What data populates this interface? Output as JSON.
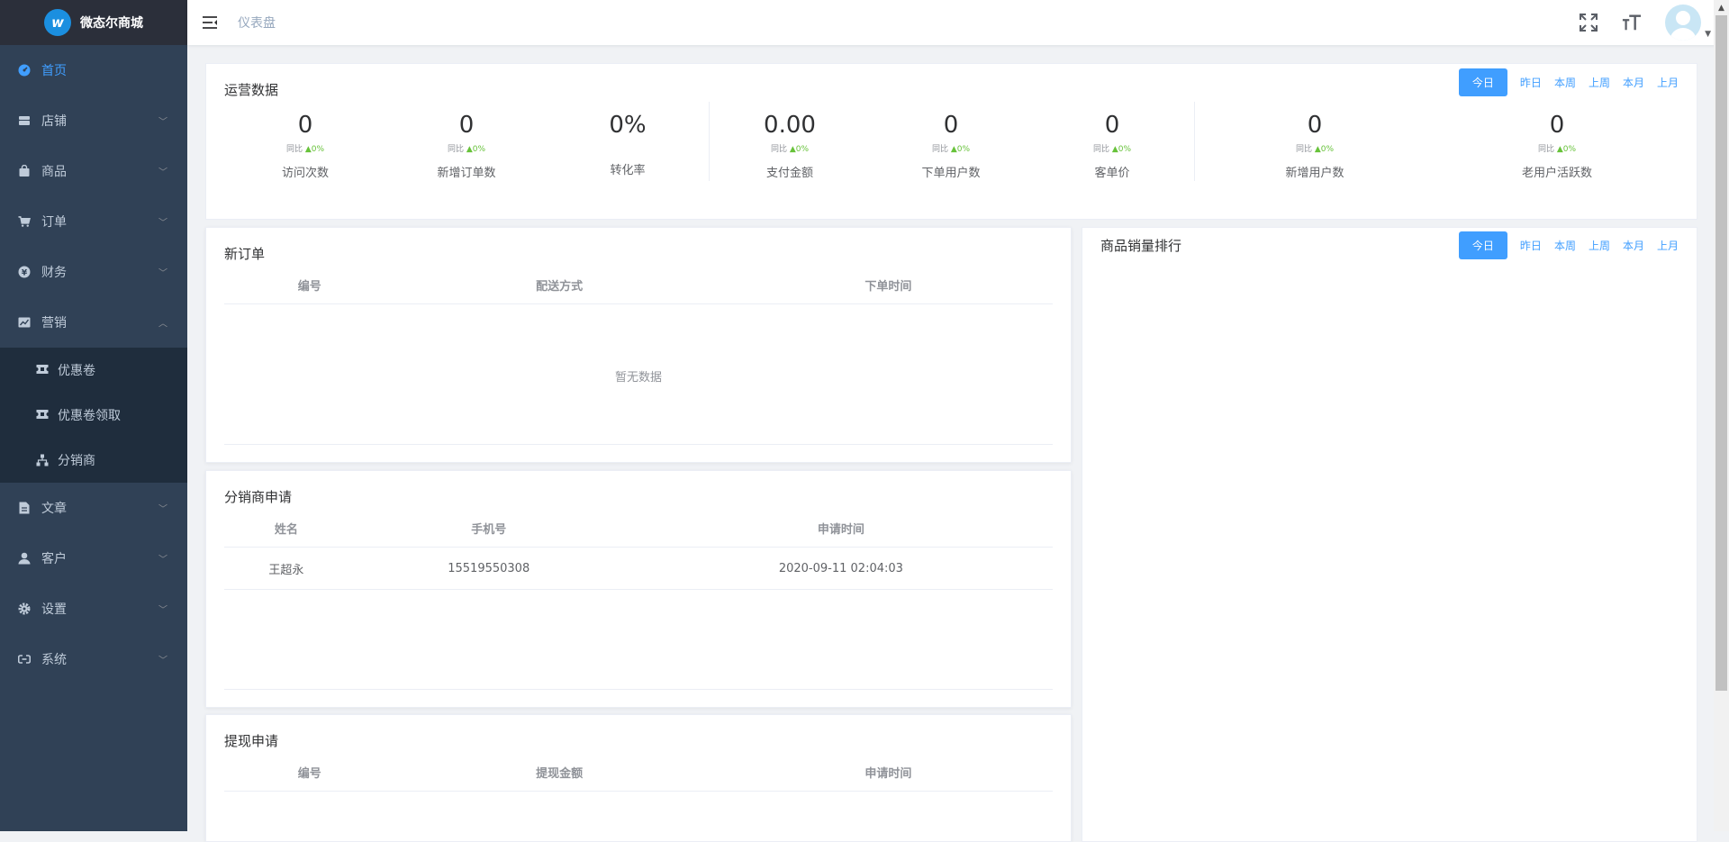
{
  "app": {
    "logo_text": "微态尔商城",
    "logo_mark": "w"
  },
  "header": {
    "breadcrumb": "仪表盘"
  },
  "sidebar": {
    "items": [
      {
        "label": "首页",
        "icon": "dashboard-icon",
        "active": true,
        "has_arrow": false
      },
      {
        "label": "店铺",
        "icon": "store-icon",
        "has_arrow": true
      },
      {
        "label": "商品",
        "icon": "bag-icon",
        "has_arrow": true
      },
      {
        "label": "订单",
        "icon": "cart-icon",
        "has_arrow": true
      },
      {
        "label": "财务",
        "icon": "yen-icon",
        "has_arrow": true
      },
      {
        "label": "营销",
        "icon": "chart-line-icon",
        "has_arrow": true,
        "expanded": true
      }
    ],
    "submenu": [
      {
        "label": "优惠卷",
        "icon": "ticket-icon"
      },
      {
        "label": "优惠卷领取",
        "icon": "ticket-icon"
      },
      {
        "label": "分销商",
        "icon": "org-icon"
      }
    ],
    "items_after": [
      {
        "label": "文章",
        "icon": "document-icon",
        "has_arrow": true
      },
      {
        "label": "客户",
        "icon": "user-icon",
        "has_arrow": true
      },
      {
        "label": "设置",
        "icon": "gear-icon",
        "has_arrow": true
      },
      {
        "label": "系统",
        "icon": "link-icon",
        "has_arrow": true
      }
    ]
  },
  "range_tabs": [
    "今日",
    "昨日",
    "本周",
    "上周",
    "本月",
    "上月"
  ],
  "operations": {
    "title": "运营数据",
    "stats": [
      {
        "value": "0",
        "compare_label": "同比",
        "compare_value": "0%",
        "label": "访问次数"
      },
      {
        "value": "0",
        "compare_label": "同比",
        "compare_value": "0%",
        "label": "新增订单数"
      },
      {
        "value": "0%",
        "compare_label": "",
        "compare_value": "",
        "label": "转化率"
      },
      {
        "value": "0.00",
        "compare_label": "同比",
        "compare_value": "0%",
        "label": "支付金额"
      },
      {
        "value": "0",
        "compare_label": "同比",
        "compare_value": "0%",
        "label": "下单用户数"
      },
      {
        "value": "0",
        "compare_label": "同比",
        "compare_value": "0%",
        "label": "客单价"
      },
      {
        "value": "0",
        "compare_label": "同比",
        "compare_value": "0%",
        "label": "新增用户数"
      },
      {
        "value": "0",
        "compare_label": "同比",
        "compare_value": "0%",
        "label": "老用户活跃数"
      }
    ]
  },
  "new_orders": {
    "title": "新订单",
    "columns": [
      "编号",
      "配送方式",
      "下单时间"
    ],
    "empty_text": "暂无数据"
  },
  "distributor_apply": {
    "title": "分销商申请",
    "columns": [
      "姓名",
      "手机号",
      "申请时间"
    ],
    "rows": [
      [
        "王超永",
        "15519550308",
        "2020-09-11 02:04:03"
      ]
    ]
  },
  "withdraw_apply": {
    "title": "提现申请",
    "columns": [
      "编号",
      "提现金额",
      "申请时间"
    ]
  },
  "sales_rank": {
    "title": "商品销量排行"
  },
  "colors": {
    "accent": "#409eff",
    "sidebar_bg": "#304156",
    "submenu_bg": "#1f2d3d",
    "up": "#67c23a"
  }
}
